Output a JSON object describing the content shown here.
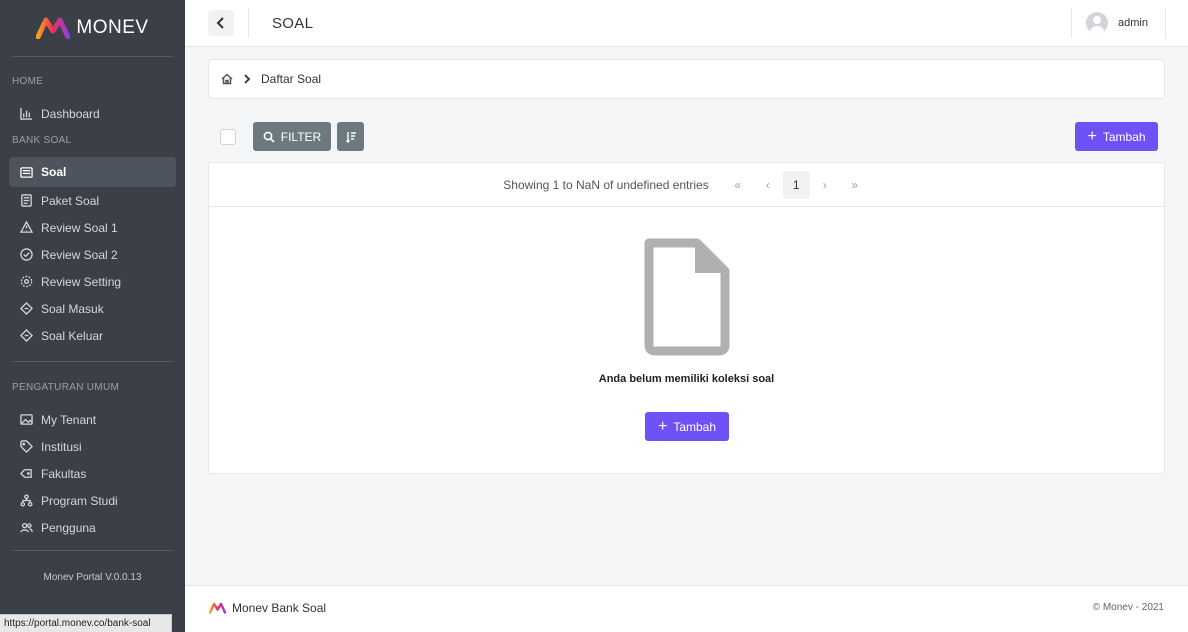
{
  "brand": {
    "name": "MONEV"
  },
  "sidebar": {
    "sections": {
      "home": "HOME",
      "bank_soal": "BANK SOAL",
      "pengaturan": "PENGATURAN UMUM"
    },
    "items": [
      {
        "label": "Dashboard",
        "icon": "chart-icon"
      },
      {
        "label": "Soal",
        "icon": "list-icon",
        "active": true
      },
      {
        "label": "Paket Soal",
        "icon": "document-icon"
      },
      {
        "label": "Review Soal 1",
        "icon": "warning-icon"
      },
      {
        "label": "Review Soal 2",
        "icon": "check-circle-icon"
      },
      {
        "label": "Review Setting",
        "icon": "gear-icon"
      },
      {
        "label": "Soal Masuk",
        "icon": "diamond-icon"
      },
      {
        "label": "Soal Keluar",
        "icon": "diamond-icon"
      },
      {
        "label": "My Tenant",
        "icon": "image-icon"
      },
      {
        "label": "Institusi",
        "icon": "tag-icon"
      },
      {
        "label": "Fakultas",
        "icon": "tags-icon"
      },
      {
        "label": "Program Studi",
        "icon": "hierarchy-icon"
      },
      {
        "label": "Pengguna",
        "icon": "users-icon"
      }
    ],
    "version": "Monev Portal V.0.0.13"
  },
  "status_url": "https://portal.monev.co/bank-soal",
  "header": {
    "title": "SOAL",
    "user": "admin"
  },
  "breadcrumb": {
    "current": "Daftar Soal"
  },
  "toolbar": {
    "filter_label": "FILTER",
    "add_label": "Tambah"
  },
  "pager": {
    "text": "Showing 1 to NaN of undefined entries",
    "current_page": "1"
  },
  "empty": {
    "message": "Anda belum memiliki koleksi soal",
    "add_label": "Tambah"
  },
  "footer": {
    "left": "Monev Bank Soal",
    "right": "© Monev - 2021"
  },
  "colors": {
    "sidebar_bg": "#3b4048",
    "accent": "#6e52f5",
    "filter_btn": "#6c7a80"
  }
}
